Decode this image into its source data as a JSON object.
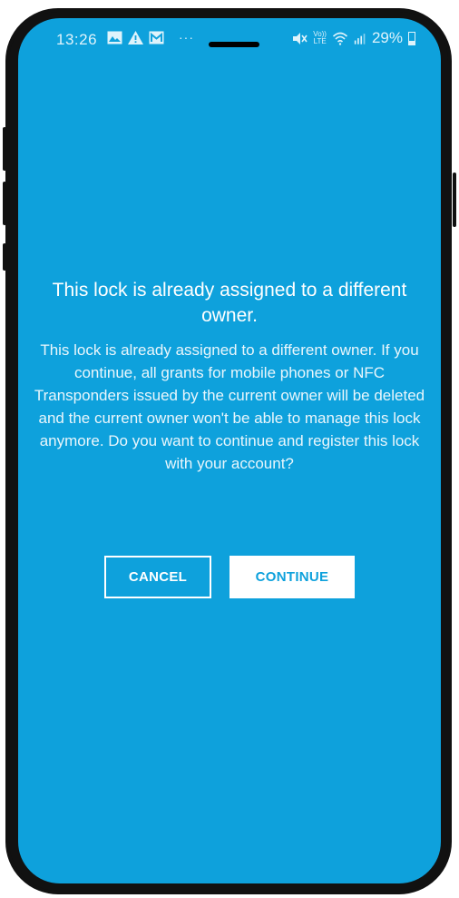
{
  "status_bar": {
    "time": "13:26",
    "left_icons": [
      "image-icon",
      "warning-icon",
      "gmail-icon"
    ],
    "more": "···",
    "right_icons": [
      "mute-icon",
      "volte-icon",
      "wifi-icon",
      "signal-icon"
    ],
    "volte_top": "Vo))",
    "volte_bottom": "LTE",
    "battery": "29%"
  },
  "dialog": {
    "title": "This lock is already assigned to a different owner.",
    "body": "This lock is already assigned to a different owner. If you continue, all grants for mobile phones or NFC Transponders issued by the current owner will be deleted and the current owner won't be able to manage this lock anymore. Do you want to continue and register this lock with your account?",
    "cancel_label": "CANCEL",
    "continue_label": "CONTINUE"
  },
  "colors": {
    "background": "#0ea1dc",
    "text": "#ffffff",
    "continue_text": "#0ea1dc"
  }
}
